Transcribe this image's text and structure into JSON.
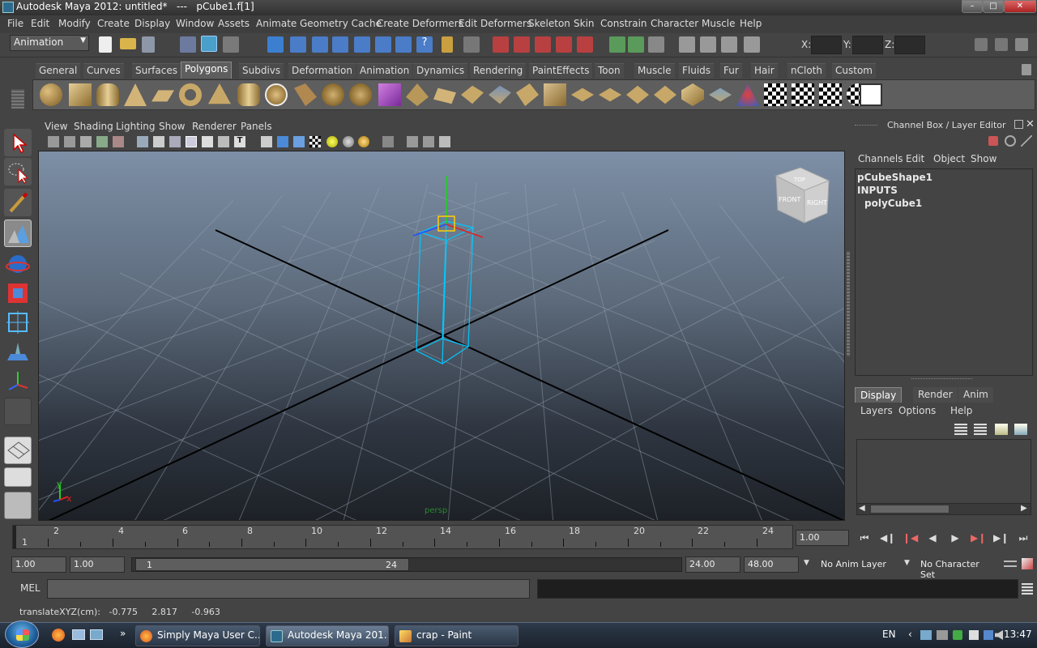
{
  "window": {
    "title": "Autodesk Maya 2012: untitled*   ---   pCube1.f[1]",
    "buttons": [
      "minimize",
      "maximize",
      "close"
    ]
  },
  "menubar": [
    "File",
    "Edit",
    "Modify",
    "Create",
    "Display",
    "Window",
    "Assets",
    "Animate",
    "Geometry Cache",
    "Create Deformers",
    "Edit Deformers",
    "Skeleton",
    "Skin",
    "Constrain",
    "Character",
    "Muscle",
    "Help"
  ],
  "statusline": {
    "mode": "Animation",
    "x_label": "X:",
    "y_label": "Y:",
    "z_label": "Z:"
  },
  "shelf_tabs": [
    "General",
    "Curves",
    "Surfaces",
    "Polygons",
    "Subdivs",
    "Deformation",
    "Animation",
    "Dynamics",
    "Rendering",
    "PaintEffects",
    "Toon",
    "Muscle",
    "Fluids",
    "Fur",
    "Hair",
    "nCloth",
    "Custom"
  ],
  "shelf_active": "Polygons",
  "shelf_icons": [
    "poly-sphere-icon",
    "poly-cube-icon",
    "poly-cylinder-icon",
    "poly-cone-icon",
    "poly-plane-icon",
    "poly-torus-icon",
    "poly-pyramid-icon",
    "poly-pipe-icon",
    "poly-soccer-ball-icon",
    "combine-icon",
    "separate-icon",
    "extract-icon",
    "smooth-icon",
    "boolean-icon",
    "average-vertices-icon",
    "bridge-icon",
    "extrude-icon",
    "bevel-icon",
    "append-polygon-icon",
    "split-polygon-icon",
    "insert-edge-loop-icon",
    "offset-edge-loop-icon",
    "merge-vertices-icon",
    "collapse-icon",
    "fill-hole-icon",
    "delete-edge-icon",
    "sculpt-geometry-icon",
    "planar-mapping-icon",
    "cylindrical-mapping-icon",
    "spherical-mapping-icon",
    "automatic-mapping-icon",
    "uv-texture-editor-icon"
  ],
  "panel_menu": [
    "View",
    "Shading",
    "Lighting",
    "Show",
    "Renderer",
    "Panels"
  ],
  "viewport": {
    "camera_label": "persp",
    "axis_x": "x",
    "axis_y": "y",
    "viewcube_top": "TOP",
    "viewcube_front": "FRONT",
    "viewcube_right": "RIGHT"
  },
  "channel_box": {
    "title": "Channel Box / Layer Editor",
    "menu": [
      "Channels",
      "Edit",
      "Object",
      "Show"
    ],
    "items": [
      "pCubeShape1",
      "INPUTS",
      "polyCube1"
    ]
  },
  "layer_editor": {
    "tabs": [
      "Display",
      "Render",
      "Anim"
    ],
    "active_tab": "Display",
    "menu": [
      "Layers",
      "Options",
      "Help"
    ]
  },
  "timeline": {
    "start_label": "1",
    "tick_labels": [
      "2",
      "4",
      "6",
      "8",
      "10",
      "12",
      "14",
      "16",
      "18",
      "20",
      "22",
      "24"
    ],
    "current_frame": "1.00",
    "playback": [
      "go-to-start",
      "step-back-key",
      "step-back-frame",
      "play-back",
      "play-forward",
      "step-forward-frame",
      "step-forward-key",
      "go-to-end"
    ]
  },
  "range": {
    "anim_start": "1.00",
    "playback_start": "1.00",
    "range_start_label": "1",
    "range_end_label": "24",
    "playback_end": "24.00",
    "anim_end": "48.00",
    "anim_layer": "No Anim Layer",
    "character_set": "No Character Set"
  },
  "command_line": {
    "label": "MEL"
  },
  "help_line": {
    "text": "translateXYZ(cm):   -0.775     2.817     -0.963"
  },
  "taskbar": {
    "tasks": [
      {
        "label": "Simply Maya User C...",
        "icon": "firefox-icon"
      },
      {
        "label": "Autodesk Maya 201...",
        "icon": "maya-icon"
      },
      {
        "label": "crap - Paint",
        "icon": "paint-icon"
      }
    ],
    "language": "EN",
    "time": "13:47"
  },
  "colors": {
    "accent_selected": "#00c8ff",
    "manip_x": "#e02020",
    "manip_y": "#20d020",
    "manip_z": "#2050ff",
    "manip_center": "#ffd000"
  }
}
